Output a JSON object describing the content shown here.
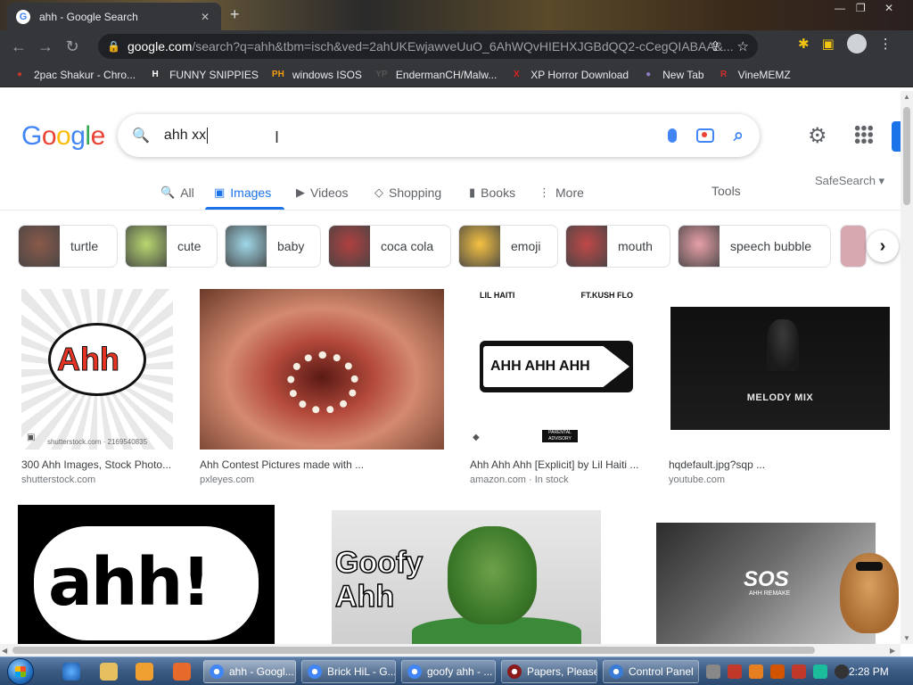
{
  "browser": {
    "tab_title": "ahh - Google Search",
    "url_host": "google.com",
    "url_rest": "/search?q=ahh&tbm=isch&ved=2ahUKEwjawveUuO_6AhWQvHIEHXJGBdQQ2-cCegQIABAA&...",
    "bookmarks": [
      {
        "label": "2pac Shakur - Chro...",
        "icon": "person-icon",
        "color": "#c0392b"
      },
      {
        "label": "FUNNY SNIPPIES",
        "icon": "H",
        "color": "#ffffff"
      },
      {
        "label": "windows ISOS",
        "icon": "PH",
        "color": "#f39c12"
      },
      {
        "label": "EndermanCH/Malw...",
        "icon": "YP",
        "color": "#555555"
      },
      {
        "label": "XP Horror Download",
        "icon": "X",
        "color": "#e02020"
      },
      {
        "label": "New Tab",
        "icon": "globe-icon",
        "color": "#8e7cc3"
      },
      {
        "label": "VineMEMZ",
        "icon": "R",
        "color": "#d32f2f"
      }
    ]
  },
  "search": {
    "query": "ahh xx",
    "logo_letters": [
      "G",
      "o",
      "o",
      "g",
      "l",
      "e"
    ],
    "logo_colors": [
      "#4285f4",
      "#ea4335",
      "#fbbc05",
      "#4285f4",
      "#34a853",
      "#ea4335"
    ]
  },
  "tabs": [
    {
      "label": "All",
      "icon": "🔍"
    },
    {
      "label": "Images",
      "icon": "▣"
    },
    {
      "label": "Videos",
      "icon": "▶"
    },
    {
      "label": "Shopping",
      "icon": "◇"
    },
    {
      "label": "Books",
      "icon": "▮"
    },
    {
      "label": "More",
      "icon": "⋮"
    }
  ],
  "tools_label": "Tools",
  "safesearch_label": "SafeSearch ▾",
  "chips": [
    {
      "label": "turtle",
      "color": "#8a5a4a"
    },
    {
      "label": "cute",
      "color": "#b8d870"
    },
    {
      "label": "baby",
      "color": "#9fd8e8"
    },
    {
      "label": "coca cola",
      "color": "#b04040"
    },
    {
      "label": "emoji",
      "color": "#f5c242"
    },
    {
      "label": "mouth",
      "color": "#c04848"
    },
    {
      "label": "speech bubble",
      "color": "#e8a0a8"
    }
  ],
  "results": [
    {
      "caption": "300 Ahh Images, Stock Photo...",
      "source": "shutterstock.com",
      "bubble_text": "Ahh",
      "watermark": "shutterstock.com · 2169540835"
    },
    {
      "caption": "Ahh Contest Pictures made with ...",
      "source": "pxleyes.com"
    },
    {
      "caption": "Ahh Ahh Ahh [Explicit] by Lil Haiti ...",
      "source": "amazon.com · In stock",
      "sign_text": "AHH AHH AHH",
      "artist_left": "LIL HAITI",
      "artist_right": "FT.KUSH FLO",
      "advisory": "PARENTAL ADVISORY EXPLICIT CONTENT"
    },
    {
      "caption": "hqdefault.jpg?sqp ...",
      "source": "youtube.com",
      "mix_title": "MELODY MIX"
    },
    {
      "word": "ahh!"
    },
    {
      "line1": "Goofy",
      "line2": "Ahh"
    },
    {
      "title": "SOS",
      "subtitle": "AHH REMAKE"
    }
  ],
  "taskbar": {
    "tasks": [
      {
        "label": "ahh - Googl...",
        "color": "#4285f4"
      },
      {
        "label": "Brick HiL - G...",
        "color": "#4285f4"
      },
      {
        "label": "goofy ahh - ...",
        "color": "#4285f4"
      },
      {
        "label": "Papers, Please",
        "color": "#8b1a1a"
      },
      {
        "label": "Control Panel",
        "color": "#3a7bd5"
      }
    ],
    "clock": "2:28 PM"
  }
}
